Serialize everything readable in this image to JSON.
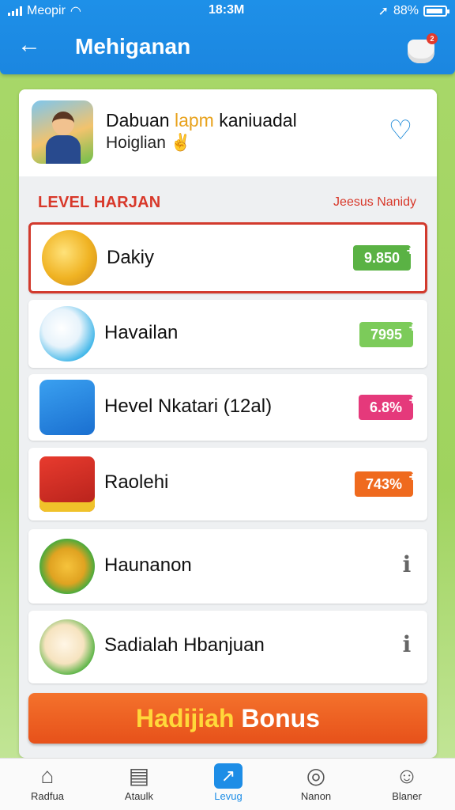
{
  "status_bar": {
    "carrier": "Meopir",
    "time": "18:3M",
    "battery": "88%"
  },
  "header": {
    "title": "Mehiganan",
    "notification_count": "2"
  },
  "profile": {
    "name_prefix": "Dabuan ",
    "name_highlight": "lapm",
    "name_suffix": " kaniuadal",
    "subtitle": "Hoiglian ✌"
  },
  "section": {
    "title": "LEVEL HARJAN",
    "link": "Jeesus Nanidy"
  },
  "rows": [
    {
      "label": "Dakiy",
      "value": "9.850",
      "color": "#5ab244",
      "icon": "coin-icon"
    },
    {
      "label": "Havailan",
      "value": "7995",
      "color": "#7ccb5a",
      "icon": "bird-icon"
    },
    {
      "label": "Hevel Nkatari (12al)",
      "value": "6.8%",
      "color": "#e5397b",
      "icon": "wallet-icon"
    },
    {
      "label": "Raolehi",
      "value": "743%",
      "color": "#ef6a1e",
      "icon": "chest-icon"
    },
    {
      "label": "Haunanon",
      "icon": "gift-icon"
    },
    {
      "label": "Sadialah Hbanjuan",
      "icon": "chick-icon"
    }
  ],
  "bonus_button": {
    "highlight": "Hadijiah",
    "rest": " Bonus"
  },
  "nav": [
    {
      "label": "Radfua",
      "icon": "home-icon"
    },
    {
      "label": "Ataulk",
      "icon": "news-icon"
    },
    {
      "label": "Levug",
      "icon": "chart-icon",
      "active": true
    },
    {
      "label": "Nanon",
      "icon": "alert-icon"
    },
    {
      "label": "Blaner",
      "icon": "profile-icon"
    }
  ]
}
